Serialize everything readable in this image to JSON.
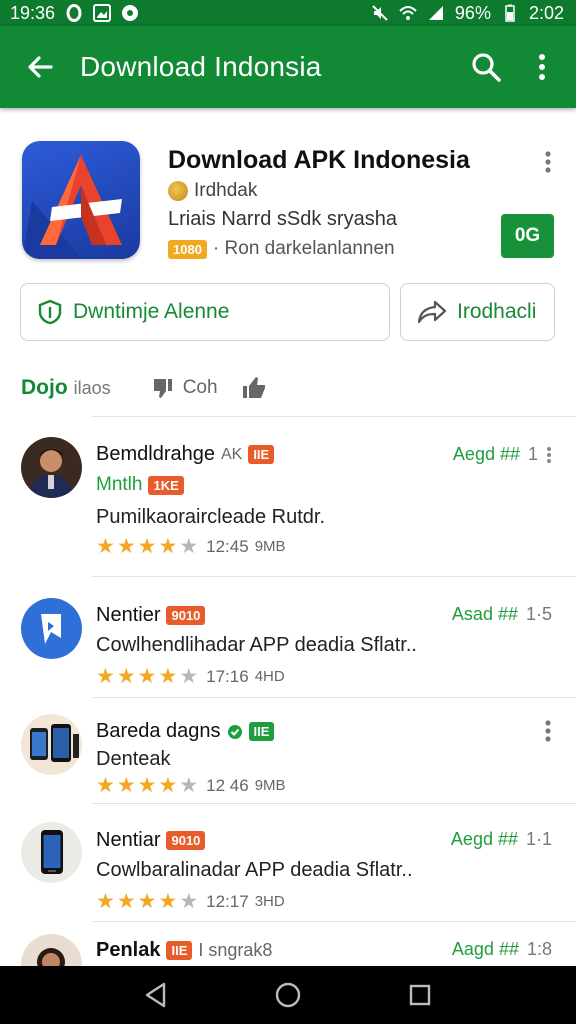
{
  "status_bar": {
    "time_left": "19:36",
    "battery": "96%",
    "time_right": "2:02"
  },
  "app_bar": {
    "title": "Download Indonsia"
  },
  "app": {
    "title": "Download APK Indonesia",
    "developer": "Irdhdak",
    "subtitle": "Lriais Narrd sSdk sryasha",
    "badge": "1080",
    "tagline": "· Ron darkelanlannen",
    "rating_box": "0G"
  },
  "buttons": {
    "main": "Dwntimje Alenne",
    "share": "Irodhacli"
  },
  "filters": {
    "label": "Dojo",
    "sub": "ilaos",
    "icon_label": "Coh"
  },
  "rows": [
    {
      "name": "Bemdldrahge",
      "name_small": "AK",
      "name_badge": "IIE",
      "line2": "Mntlh",
      "line2_badge": "1KE",
      "desc": "Pumilkaorairclead‍e Rutdr.",
      "meta": "Aegd ##",
      "meta_num": "1",
      "time": "12:45",
      "size": "9MB",
      "stars": 4
    },
    {
      "name": "Nentier",
      "name_badge": "9010",
      "desc": "Cowlhendlihadar APP deadia Sflatr..",
      "meta": "Asad ##",
      "meta_num": "1·5",
      "time": "17:16",
      "size": "4HD",
      "stars": 4
    },
    {
      "name": "Bareda dagns",
      "name_badge": "IIE",
      "line2": "Denteak",
      "time": "12 46",
      "size": "9MB",
      "stars": 4
    },
    {
      "name": "Nentiar",
      "name_badge": "9010",
      "desc": "Cowlbaralinadar APP deadia Sflatr..",
      "meta": "Aegd ##",
      "meta_num": "1·1",
      "time": "12:17",
      "size": "3HD",
      "stars": 4
    },
    {
      "name": "Penlak",
      "name_badge": "IIE",
      "name_extra": "I sngrak8",
      "meta": "Aagd ##",
      "meta_num": "1:8"
    }
  ],
  "colors": {
    "primary": "#128a35",
    "status": "#0d7a2e",
    "accent_green": "#1e9e3d",
    "star": "#f5a623",
    "badge_orange": "#e85b2b",
    "badge_yellow": "#f1a91f"
  }
}
